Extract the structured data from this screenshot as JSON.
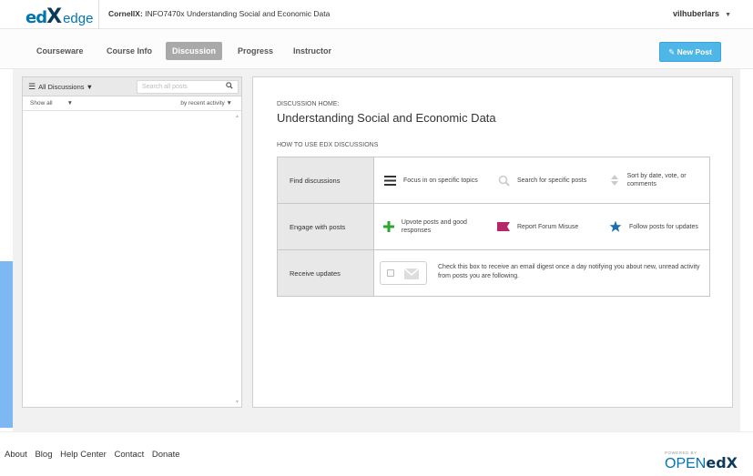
{
  "header": {
    "logo_ed": "ed",
    "logo_x": "X",
    "logo_edge": "edge",
    "course_org": "CornellX:",
    "course_name": "INFO7470x Understanding Social and Economic Data",
    "username": "vilhuberlars",
    "user_caret": "▼"
  },
  "nav": {
    "tabs": [
      {
        "label": "Courseware"
      },
      {
        "label": "Course Info"
      },
      {
        "label": "Discussion"
      },
      {
        "label": "Progress"
      },
      {
        "label": "Instructor"
      }
    ],
    "active_tab": "Discussion",
    "new_post_label": "New Post"
  },
  "sidebar": {
    "menu_label": "All Discussions ▼",
    "search_placeholder": "Search all posts",
    "filter_label": "Show all",
    "filter_caret": "▼",
    "sort_label": "by recent activity ▼"
  },
  "main": {
    "home_label": "DISCUSSION HOME:",
    "title": "Understanding Social and Economic Data",
    "how_to_label": "HOW TO USE EDX DISCUSSIONS",
    "rows": [
      {
        "label": "Find discussions",
        "items": [
          {
            "icon": "list-icon",
            "text": "Focus in on specific topics"
          },
          {
            "icon": "search-icon",
            "text": "Search for specific posts"
          },
          {
            "icon": "sort-icon",
            "text": "Sort by date, vote, or comments"
          }
        ]
      },
      {
        "label": "Engage with posts",
        "items": [
          {
            "icon": "plus-icon",
            "text": "Upvote posts and good responses"
          },
          {
            "icon": "flag-icon",
            "text": "Report Forum Misuse"
          },
          {
            "icon": "star-icon",
            "text": "Follow posts for updates"
          }
        ]
      },
      {
        "label": "Receive updates",
        "text": "Check this box to receive an email digest once a day notifying you about new, unread activity from posts you are following."
      }
    ]
  },
  "footer": {
    "links": [
      "About",
      "Blog",
      "Help Center",
      "Contact",
      "Donate"
    ],
    "powered_by": "POWERED BY",
    "brand_open": "OPEN",
    "brand_edx": "edX"
  },
  "colors": {
    "accent": "#0075b4",
    "new_post_bg": "#4fb6e8",
    "active_tab_bg": "#a9a9a9",
    "plus_green": "#2ea52e",
    "flag_magenta": "#b5266b",
    "star_blue": "#1a6fb0"
  }
}
